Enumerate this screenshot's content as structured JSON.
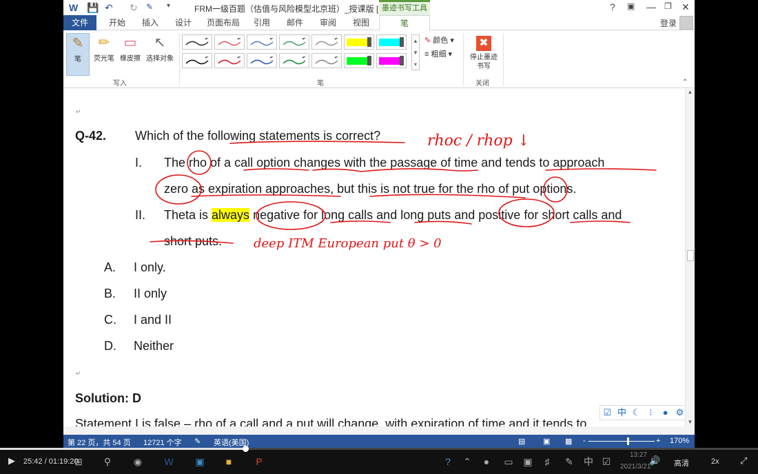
{
  "window": {
    "title": "FRM一级百题（估值与风险模型北京班）_授课版 [兼容...",
    "context_tab": "墨迹书写工具",
    "help": "?",
    "login": "登录"
  },
  "tabs": [
    "文件",
    "开始",
    "插入",
    "设计",
    "页面布局",
    "引用",
    "邮件",
    "审阅",
    "视图",
    "笔"
  ],
  "ribbon": {
    "write_group": {
      "label": "写入",
      "tools": [
        {
          "label": "笔",
          "icon": "pen-icon"
        },
        {
          "label": "荧光笔",
          "icon": "highlighter-icon"
        },
        {
          "label": "橡皮擦",
          "icon": "eraser-icon"
        },
        {
          "label": "选择对象",
          "icon": "pointer-icon"
        }
      ]
    },
    "pens_group": {
      "label": "笔",
      "color_option": "颜色",
      "thickness_option": "粗细",
      "pen_colors_row1": [
        "#333333",
        "#e0606a",
        "#5a7fc0",
        "#4aa070",
        "#999999",
        "#ffff00",
        "#00ffff"
      ],
      "pen_colors_row2": [
        "#111111",
        "#d81e2c",
        "#2a5ab0",
        "#1e8a3e",
        "#888888",
        "#00ff22",
        "#ff00ff"
      ]
    },
    "close_group": {
      "label": "关闭",
      "stop_label": "停止墨迹书写"
    }
  },
  "document": {
    "question_number": "Q-42.",
    "question": "Which of the following statements is correct?",
    "statements": [
      {
        "num": "I.",
        "line1": [
          "The ",
          "rho",
          " of a call option changes with the passage of time and tends to approach"
        ],
        "line2": "zero as expiration approaches, but this is not true for the rho of put options."
      },
      {
        "num": "II.",
        "line1_pre": "Theta is ",
        "line1_hl": "always",
        "line1_post": " negative for long calls and long puts and positive for short calls and",
        "line2": "short puts."
      }
    ],
    "options": [
      {
        "letter": "A.",
        "text": "I only."
      },
      {
        "letter": "B.",
        "text": "II only"
      },
      {
        "letter": "C.",
        "text": "I and II"
      },
      {
        "letter": "D.",
        "text": "Neither"
      }
    ],
    "solution": "Solution: D",
    "next_line": "Statement I is false – rho of a call and a put will change, with expiration of time and it tends to",
    "handwriting": {
      "note1": "rhoc / rhop ↓",
      "note2": "deep ITM European put θ > 0"
    },
    "ink_color": "#e01515"
  },
  "statusbar": {
    "page": "第 22 页，共 54 页",
    "words": "12721 个字",
    "language": "英语(美国)",
    "zoom_minus": "-",
    "zoom_plus": "+",
    "zoom": "170%"
  },
  "player": {
    "time": "25:42 / 01:19:20",
    "clock_time": "13:27",
    "clock_date": "2021/3/21",
    "ime": "中",
    "quality": "高清",
    "speed": "2x",
    "progress": 0.324
  }
}
